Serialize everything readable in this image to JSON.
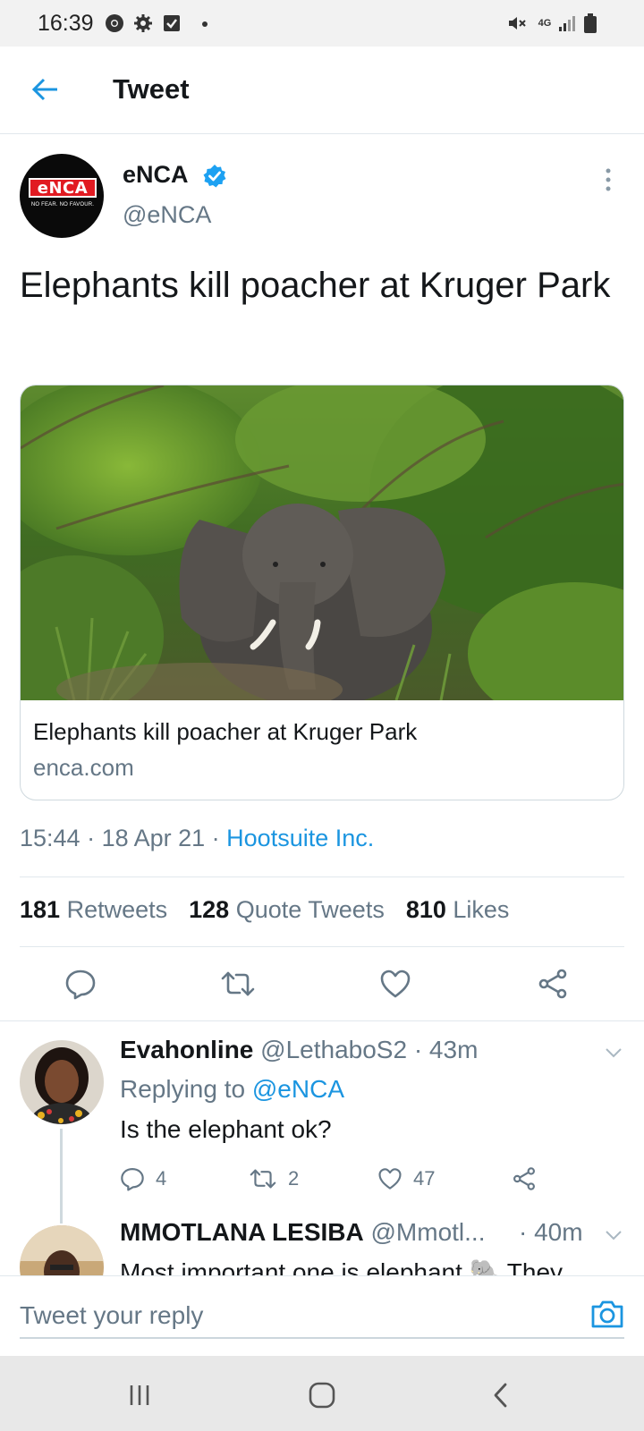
{
  "status_bar": {
    "time": "16:39",
    "network": "4G"
  },
  "header": {
    "title": "Tweet"
  },
  "tweet": {
    "author_name": "eNCA",
    "author_handle": "@eNCA",
    "avatar_logo_text": "eNCA",
    "avatar_tagline": "NO FEAR. NO FAVOUR.",
    "text": "Elephants kill poacher at Kruger Park",
    "card": {
      "title": "Elephants kill poacher at Kruger Park",
      "domain": "enca.com"
    },
    "meta": {
      "time": "15:44",
      "date": "18 Apr 21",
      "separator": " · ",
      "source": "Hootsuite Inc."
    },
    "stats": {
      "retweets_count": "181",
      "retweets_label": "Retweets",
      "quotes_count": "128",
      "quotes_label": "Quote Tweets",
      "likes_count": "810",
      "likes_label": "Likes"
    }
  },
  "replies": [
    {
      "name": "Evahonline",
      "handle": "@LethaboS2",
      "time": "· 43m",
      "replying_prefix": "Replying to",
      "replying_to": "@eNCA",
      "text": "Is the elephant ok?",
      "reply_count": "4",
      "retweet_count": "2",
      "like_count": "47"
    },
    {
      "name": "MMOTLANA LESIBA",
      "handle": "@Mmotl...",
      "time": "· 40m",
      "text": "Most important one is elephant 🐘    They"
    }
  ],
  "composer": {
    "placeholder": "Tweet your reply"
  },
  "colors": {
    "accent": "#1b95e0",
    "muted": "#657786",
    "text": "#14171a",
    "enca_red": "#e11b22"
  },
  "icons": [
    "back-arrow-icon",
    "verified-badge-icon",
    "more-vertical-icon",
    "reply-icon",
    "retweet-icon",
    "like-icon",
    "share-icon",
    "chevron-down-icon",
    "camera-icon",
    "recent-apps-icon",
    "home-icon",
    "back-nav-icon"
  ]
}
